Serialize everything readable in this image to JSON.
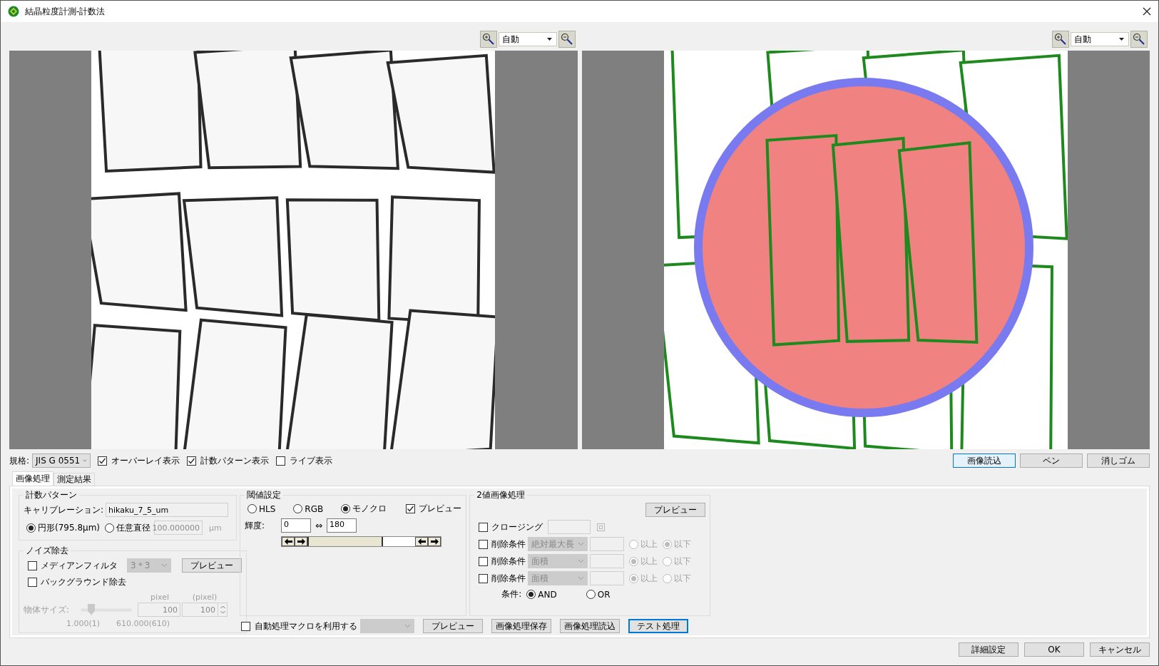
{
  "window": {
    "title": "結晶粒度計測-計数法"
  },
  "viewers": [
    {
      "zoom": "自動",
      "kind": "grains"
    },
    {
      "zoom": "自動",
      "kind": "overlay"
    }
  ],
  "options_bar": {
    "standard": {
      "label": "規格:",
      "value": "JIS G 0551"
    },
    "checkboxes": [
      {
        "label": "オーバーレイ表示",
        "checked": true
      },
      {
        "label": "計数パターン表示",
        "checked": true
      },
      {
        "label": "ライブ表示",
        "checked": false
      }
    ],
    "tool_buttons": [
      {
        "label": "画像読込",
        "selected": true
      },
      {
        "label": "ペン",
        "selected": false
      },
      {
        "label": "消しゴム",
        "selected": false
      }
    ]
  },
  "tabs": [
    {
      "label": "画像処理",
      "selected": true
    },
    {
      "label": "測定結果",
      "selected": false
    }
  ],
  "counting_pattern": {
    "title": "計数パターン",
    "calibration": {
      "label": "キャリブレーション:",
      "value": "hikaku_7_5_um"
    },
    "shapes": [
      {
        "label": "円形(795.8μm)",
        "selected": true
      },
      {
        "label": "任意直径",
        "selected": false
      }
    ],
    "diameter": {
      "value": "100.000000",
      "unit": "μm",
      "disabled": true
    }
  },
  "noise_removal": {
    "title": "ノイズ除去",
    "median": {
      "label": "メディアンフィルタ",
      "checked": false,
      "size": "3＊3",
      "disabled": true,
      "button": "プレビュー"
    },
    "background": {
      "label": "バックグラウンド除去",
      "checked": false
    },
    "object_size": {
      "label": "物体サイズ:",
      "disabled": true,
      "level": 0.2,
      "headers": [
        "pixel",
        "(pixel)"
      ],
      "min": "100",
      "max": "100",
      "ticks": [
        "1.000(1)",
        "610.000(610)"
      ]
    }
  },
  "threshold": {
    "title": "閾値設定",
    "modes": [
      {
        "label": "HLS",
        "selected": false
      },
      {
        "label": "RGB",
        "selected": false
      },
      {
        "label": "モノクロ",
        "selected": true
      }
    ],
    "preview": {
      "label": "プレビュー",
      "checked": true
    },
    "luminance": {
      "label": "輝度:",
      "low": "0",
      "separator": "⇔",
      "high": "180",
      "level": 0.7
    }
  },
  "binary": {
    "title": "2値画像処理",
    "preview_button": "プレビュー",
    "closing": {
      "label": "クロージング",
      "checked": false,
      "disabled": true
    },
    "delete_conditions": [
      {
        "label": "削除条件",
        "checked": false,
        "metric": "絶対最大長",
        "disabled": true,
        "bounds": [
          {
            "label": "以上",
            "selected": false
          },
          {
            "label": "以下",
            "selected": true
          }
        ]
      },
      {
        "label": "削除条件",
        "checked": false,
        "metric": "面積",
        "disabled": true,
        "bounds": [
          {
            "label": "以上",
            "selected": true
          },
          {
            "label": "以下",
            "selected": false
          }
        ]
      },
      {
        "label": "削除条件",
        "checked": false,
        "metric": "面積",
        "disabled": true,
        "bounds": [
          {
            "label": "以上",
            "selected": true
          },
          {
            "label": "以下",
            "selected": false
          }
        ]
      }
    ],
    "combine": {
      "label": "条件:",
      "options": [
        {
          "label": "AND",
          "selected": true
        },
        {
          "label": "OR",
          "selected": false
        }
      ]
    }
  },
  "macro": {
    "label": "自動処理マクロを利用する",
    "checked": false,
    "disabled": true
  },
  "actions": [
    {
      "label": "プレビュー",
      "focused": false
    },
    {
      "label": "画像処理保存",
      "focused": false
    },
    {
      "label": "画像処理読込",
      "focused": false
    },
    {
      "label": "テスト処理",
      "focused": true
    }
  ],
  "footer_buttons": [
    "詳細設定",
    "OK",
    "キャンセル"
  ]
}
